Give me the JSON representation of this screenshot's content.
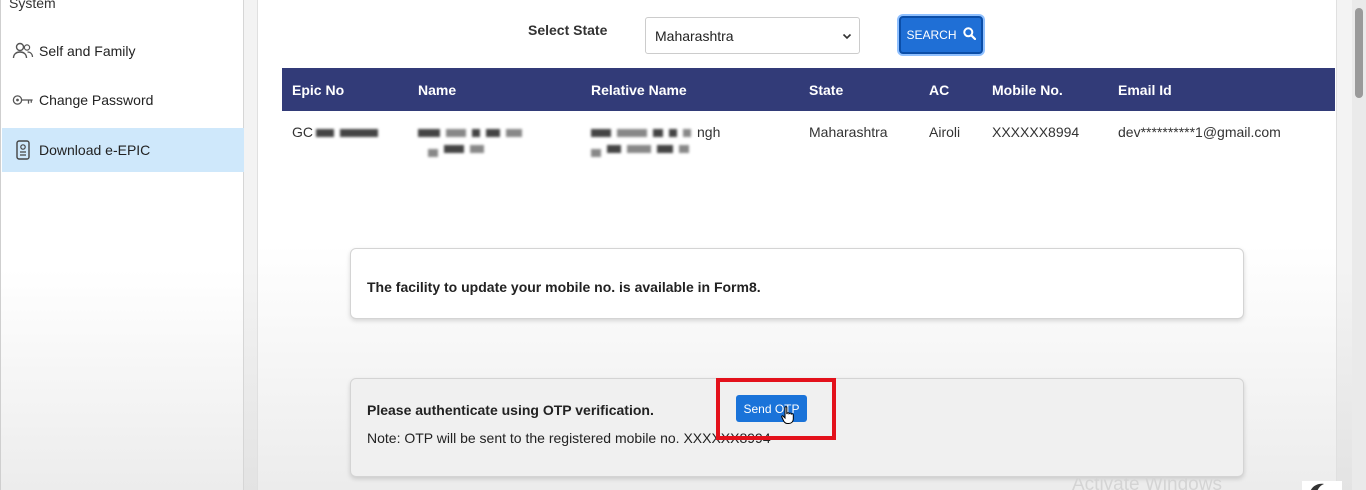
{
  "sidebar": {
    "cut_label": "System",
    "items": [
      {
        "label": "Self and Family",
        "icon": "people-icon"
      },
      {
        "label": "Change Password",
        "icon": "key-icon"
      },
      {
        "label": "Download e-EPIC",
        "icon": "id-card-icon",
        "active": true
      }
    ]
  },
  "filter": {
    "state_label": "Select State",
    "state_value": "Maharashtra",
    "search_label": "SEARCH"
  },
  "table": {
    "headers": [
      "Epic No",
      "Name",
      "Relative Name",
      "State",
      "AC",
      "Mobile No.",
      "Email Id"
    ],
    "row": {
      "epic_prefix": "GC",
      "relative_suffix": "ngh",
      "state": "Maharashtra",
      "ac": "Airoli",
      "mobile": "XXXXXX8994",
      "email": "dev**********1@gmail.com"
    }
  },
  "notice": {
    "mobile_update": "The facility to update your mobile no. is available in Form8."
  },
  "otp": {
    "title": "Please authenticate using OTP verification.",
    "note": "Note: OTP will be sent to the registered mobile no. XXXXXX8994",
    "button_label": "Send OTP"
  },
  "watermark": "Activate Windows",
  "colors": {
    "table_header": "#323b78",
    "primary_button": "#1f6fd6",
    "active_sidebar": "#cfe8fb",
    "highlight": "#e3111b"
  }
}
